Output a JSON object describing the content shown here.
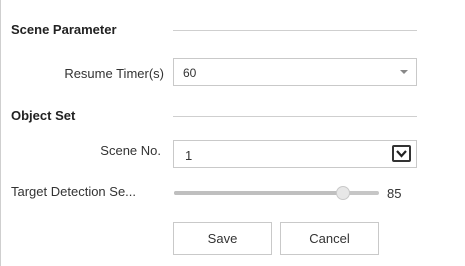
{
  "scene_parameter": {
    "title": "Scene Parameter",
    "resume_timer": {
      "label": "Resume Timer(s)",
      "value": "60"
    }
  },
  "object_set": {
    "title": "Object Set",
    "scene_no": {
      "label": "Scene No.",
      "value": "1"
    },
    "target_detection": {
      "label": "Target Detection Se...",
      "value": "85",
      "fraction": 0.85
    }
  },
  "actions": {
    "save_label": "Save",
    "cancel_label": "Cancel"
  }
}
